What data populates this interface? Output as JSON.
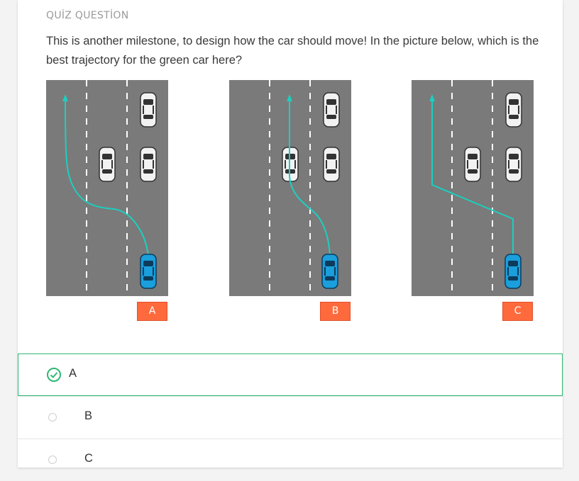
{
  "quiz": {
    "header": "QUİZ QUESTİON",
    "question": "This is another milestone, to design how the car should move! In the picture below, which is the best trajectory for the green car here?",
    "figures": [
      {
        "tag": "A"
      },
      {
        "tag": "B"
      },
      {
        "tag": "C"
      }
    ],
    "options": [
      {
        "label": "A",
        "selected": true
      },
      {
        "label": "B",
        "selected": false
      },
      {
        "label": "C",
        "selected": false
      }
    ]
  },
  "colors": {
    "road": "#7a7a7a",
    "lane_marking": "#ffffff",
    "trajectory": "#1ccfc0",
    "ego_car": "#1a9fdc",
    "other_car": "#f2f2f2",
    "tag_bg": "#ff6a3d",
    "correct": "#2eb872"
  },
  "icons": {
    "selected": "check-circle-icon",
    "unselected": "radio-empty-icon"
  }
}
